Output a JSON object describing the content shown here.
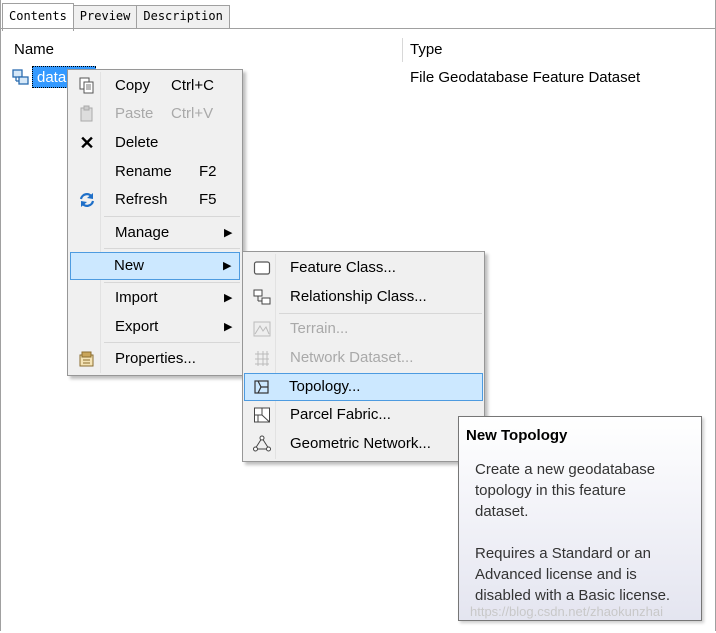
{
  "tabs": [
    "Contents",
    "Preview",
    "Description"
  ],
  "columns": {
    "name": "Name",
    "type": "Type"
  },
  "row": {
    "name": "data",
    "type": "File Geodatabase Feature Dataset"
  },
  "context_menu": {
    "copy": {
      "label": "Copy",
      "shortcut": "Ctrl+C",
      "icon": "copy-icon"
    },
    "paste": {
      "label": "Paste",
      "shortcut": "Ctrl+V",
      "icon": "paste-icon"
    },
    "delete": {
      "label": "Delete",
      "icon": "delete-icon"
    },
    "rename": {
      "label": "Rename",
      "shortcut": "F2"
    },
    "refresh": {
      "label": "Refresh",
      "shortcut": "F5",
      "icon": "refresh-icon"
    },
    "manage": {
      "label": "Manage"
    },
    "new": {
      "label": "New"
    },
    "import": {
      "label": "Import"
    },
    "export": {
      "label": "Export"
    },
    "properties": {
      "label": "Properties...",
      "icon": "properties-icon"
    }
  },
  "new_submenu": {
    "feature_class": "Feature Class...",
    "relationship_class": "Relationship Class...",
    "terrain": "Terrain...",
    "network_dataset": "Network Dataset...",
    "topology": "Topology...",
    "parcel_fabric": "Parcel Fabric...",
    "geometric_network": "Geometric Network..."
  },
  "tooltip": {
    "title": "New Topology",
    "line1": "Create a new geodatabase",
    "line2": "topology in this feature",
    "line3": "dataset.",
    "line4": "Requires a Standard or an",
    "line5": "Advanced license and is",
    "line6": "disabled with a Basic license."
  },
  "watermark": "https://blog.csdn.net/zhaokunzhai",
  "colors": {
    "selection": "#3399ff",
    "highlight": "#cce8ff",
    "highlight_border": "#4d9be0"
  }
}
